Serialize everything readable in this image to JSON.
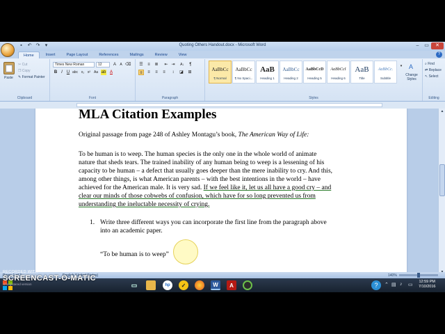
{
  "window": {
    "title": "Quoting Others Handout.docx - Microsoft Word",
    "qat": [
      "save-icon",
      "undo-icon",
      "redo-icon",
      "customize-icon"
    ],
    "controls": {
      "minimize": "–",
      "maximize": "▭",
      "close": "✕"
    }
  },
  "tabs": [
    "Home",
    "Insert",
    "Page Layout",
    "References",
    "Mailings",
    "Review",
    "View"
  ],
  "ribbon": {
    "clipboard": {
      "paste": "Paste",
      "cut": "Cut",
      "copy": "Copy",
      "format_painter": "Format Painter",
      "label": "Clipboard"
    },
    "font": {
      "name": "Times New Roman",
      "size": "12",
      "label": "Font"
    },
    "paragraph": {
      "label": "Paragraph"
    },
    "styles": {
      "label": "Styles",
      "items": [
        {
          "sample": "AaBbCc",
          "name": "¶ Normal"
        },
        {
          "sample": "AaBbCc",
          "name": "¶ No Spaci..."
        },
        {
          "sample": "AaB",
          "name": "Heading 1"
        },
        {
          "sample": "AaBbCc",
          "name": "Heading 2"
        },
        {
          "sample": "AaBbCcD",
          "name": "Heading 5"
        },
        {
          "sample": "AaBbCcI",
          "name": "Heading 6"
        },
        {
          "sample": "AaB",
          "name": "Title"
        },
        {
          "sample": "AaBbCc.",
          "name": "Subtitle"
        }
      ],
      "change_styles": "Change Styles"
    },
    "editing": {
      "find": "Find",
      "replace": "Replace",
      "select": "Select",
      "label": "Editing"
    }
  },
  "document": {
    "heading": "MLA Citation Examples",
    "intro_prefix": "Original passage from page 248 of Ashley Montagu’s book, ",
    "intro_title": "The American Way of Life:",
    "p1": "To be human is to weep.  The human species is the only one in the whole world of animate",
    "p2": "nature that sheds tears.  The trained inability of any human being to weep is a lessening of his",
    "p3": "capacity to be human – a defect that usually goes deeper than the mere inability to cry.  And this,",
    "p4": "among other things, is what American parents – with the best intentions in the world – have",
    "p5_plain": "achieved for the American male.  It is very sad. ",
    "p5_under": "If we feel like it, let us all have a good cry – and",
    "p6": "clear our minds of those cobwebs of confusion, which have for so long prevented us from",
    "p7": "understanding the ineluctable necessity of crying.",
    "list_number": "1.",
    "item1_l1": "Write three different ways you can incorporate the first line from the paragraph above",
    "item1_l2": "into an academic paper.",
    "quote": "“To be human is to weep”"
  },
  "statusbar": {
    "page": "Page: 1 of 3",
    "language": "English (United States)",
    "zoom": "140%"
  },
  "taskbar": {
    "clock_time": "12:59 PM",
    "clock_date": "7/10/2016"
  },
  "watermark": {
    "small": "RECORDED WITH",
    "big": "SCREENCAST-O-MATIC",
    "sub": "Unregistered version"
  },
  "colors": {
    "accent": "#2b579a",
    "taskbar": "#1f2b3a"
  }
}
